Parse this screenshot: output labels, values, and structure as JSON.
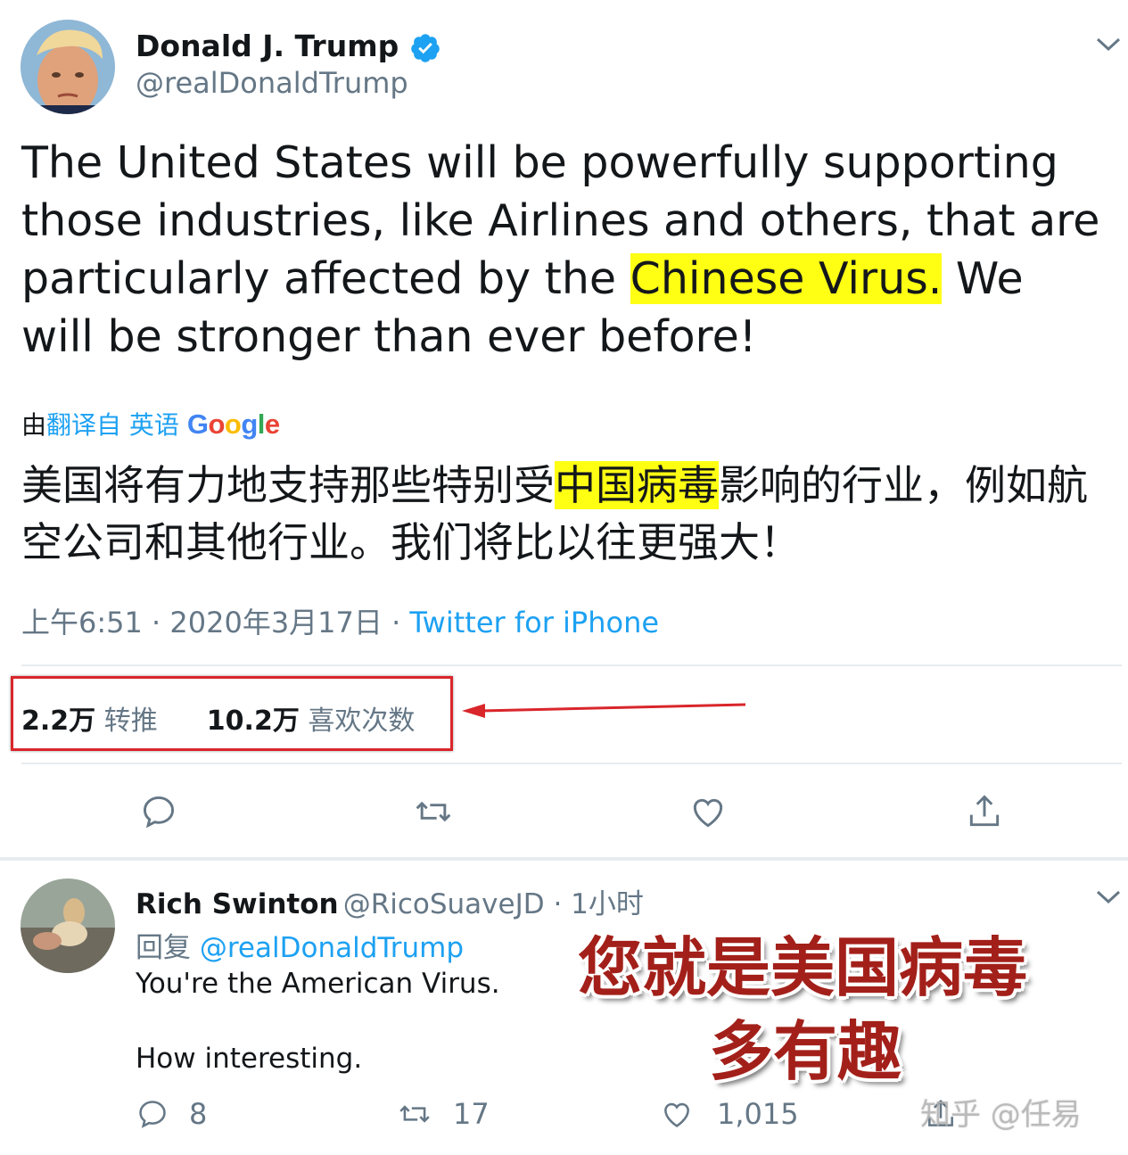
{
  "tweet": {
    "author_name": "Donald J. Trump",
    "author_handle": "@realDonaldTrump",
    "text_before": "The United States will be powerfully supporting those industries, like Airlines and others, that are particularly affected by the ",
    "text_highlight": "Chinese Virus.",
    "text_after": " We will be stronger than ever before!",
    "translation_prefix": "由",
    "translation_link": "翻译自 英语",
    "translation_provider": "Google",
    "translated_before": "美国将有力地支持那些特别受",
    "translated_highlight": "中国病毒",
    "translated_after": "影响的行业，例如航空公司和其他行业。我们将比以往更强大！",
    "time": "上午6:51 · 2020年3月17日 · ",
    "source": "Twitter for iPhone",
    "retweets_count": "2.2万",
    "retweets_label": "转推",
    "likes_count": "10.2万",
    "likes_label": "喜欢次数"
  },
  "reply": {
    "author_name": "Rich Swinton",
    "author_handle": "@RicoSuaveJD",
    "time": " · 1小时",
    "reply_prefix": "回复 ",
    "reply_to": "@realDonaldTrump",
    "line1": "You're the American Virus.",
    "line2": "How interesting.",
    "reply_count": "8",
    "retweet_count": "17",
    "like_count": "1,015"
  },
  "overlay": {
    "line1": "您就是美国病毒",
    "line2": "多有趣"
  },
  "watermark": "知乎 @任易",
  "colors": {
    "accent": "#1da1f2",
    "highlight": "#ffff14",
    "annotation_red": "#d9262b",
    "overlay_text": "#a3201a"
  }
}
